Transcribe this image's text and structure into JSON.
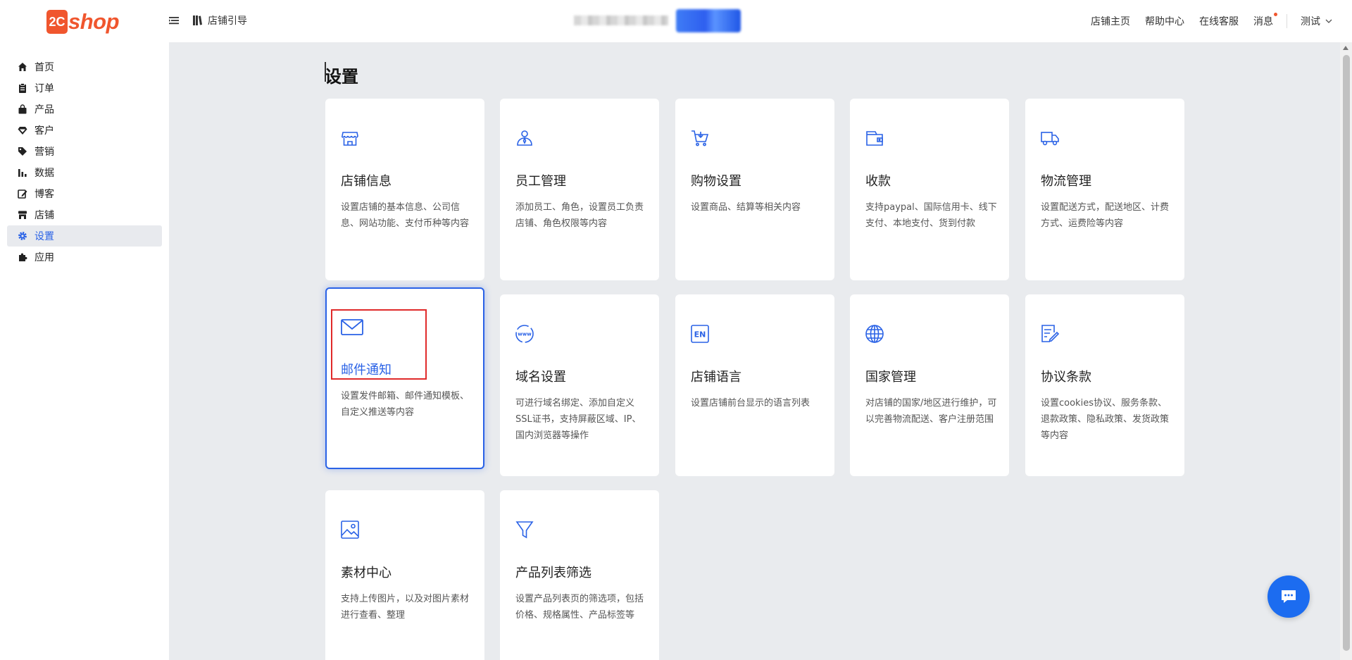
{
  "brand": {
    "logo_mark": "2C",
    "logo_text": "shop",
    "color": "#f0562e"
  },
  "header": {
    "guide_label": "店铺引导",
    "nav": [
      "店铺主页",
      "帮助中心",
      "在线客服",
      "消息"
    ],
    "user_label": "测试"
  },
  "sidebar": {
    "items": [
      {
        "label": "首页",
        "icon": "home-icon"
      },
      {
        "label": "订单",
        "icon": "clipboard-icon"
      },
      {
        "label": "产品",
        "icon": "bag-icon"
      },
      {
        "label": "客户",
        "icon": "gem-icon"
      },
      {
        "label": "营销",
        "icon": "tag-icon"
      },
      {
        "label": "数据",
        "icon": "bar-chart-icon"
      },
      {
        "label": "博客",
        "icon": "edit-icon"
      },
      {
        "label": "店铺",
        "icon": "store-icon"
      },
      {
        "label": "设置",
        "icon": "gear-icon",
        "active": true
      },
      {
        "label": "应用",
        "icon": "puzzle-icon"
      }
    ]
  },
  "page": {
    "title": "设置"
  },
  "cards": [
    {
      "title": "店铺信息",
      "desc": "设置店铺的基本信息、公司信息、网站功能、支付币种等内容",
      "icon": "shop-icon"
    },
    {
      "title": "员工管理",
      "desc": "添加员工、角色，设置员工负责店铺、角色权限等内容",
      "icon": "staff-icon"
    },
    {
      "title": "购物设置",
      "desc": "设置商品、结算等相关内容",
      "icon": "cart-icon"
    },
    {
      "title": "收款",
      "desc": "支持paypal、国际信用卡、线下支付、本地支付、货到付款",
      "icon": "wallet-icon"
    },
    {
      "title": "物流管理",
      "desc": "设置配送方式，配送地区、计费方式、运费险等内容",
      "icon": "truck-icon"
    },
    {
      "title": "邮件通知",
      "desc": "设置发件邮箱、邮件通知模板、自定义推送等内容",
      "icon": "mail-icon",
      "selected": true
    },
    {
      "title": "域名设置",
      "desc": "可进行域名绑定、添加自定义SSL证书，支持屏蔽区域、IP、国内浏览器等操作",
      "icon": "www-icon"
    },
    {
      "title": "店铺语言",
      "desc": "设置店铺前台显示的语言列表",
      "icon": "language-en-icon"
    },
    {
      "title": "国家管理",
      "desc": "对店铺的国家/地区进行维护，可以完善物流配送、客户注册范围",
      "icon": "globe-icon"
    },
    {
      "title": "协议条款",
      "desc": "设置cookies协议、服务条款、退款政策、隐私政策、发货政策等内容",
      "icon": "document-pen-icon"
    },
    {
      "title": "素材中心",
      "desc": "支持上传图片，以及对图片素材进行查看、整理",
      "icon": "image-icon"
    },
    {
      "title": "产品列表筛选",
      "desc": "设置产品列表页的筛选项，包括价格、规格属性、产品标签等",
      "icon": "filter-icon"
    }
  ],
  "colors": {
    "accent": "#2a62e6",
    "highlight": "#e02a2a",
    "chat": "#1c6cf0"
  }
}
